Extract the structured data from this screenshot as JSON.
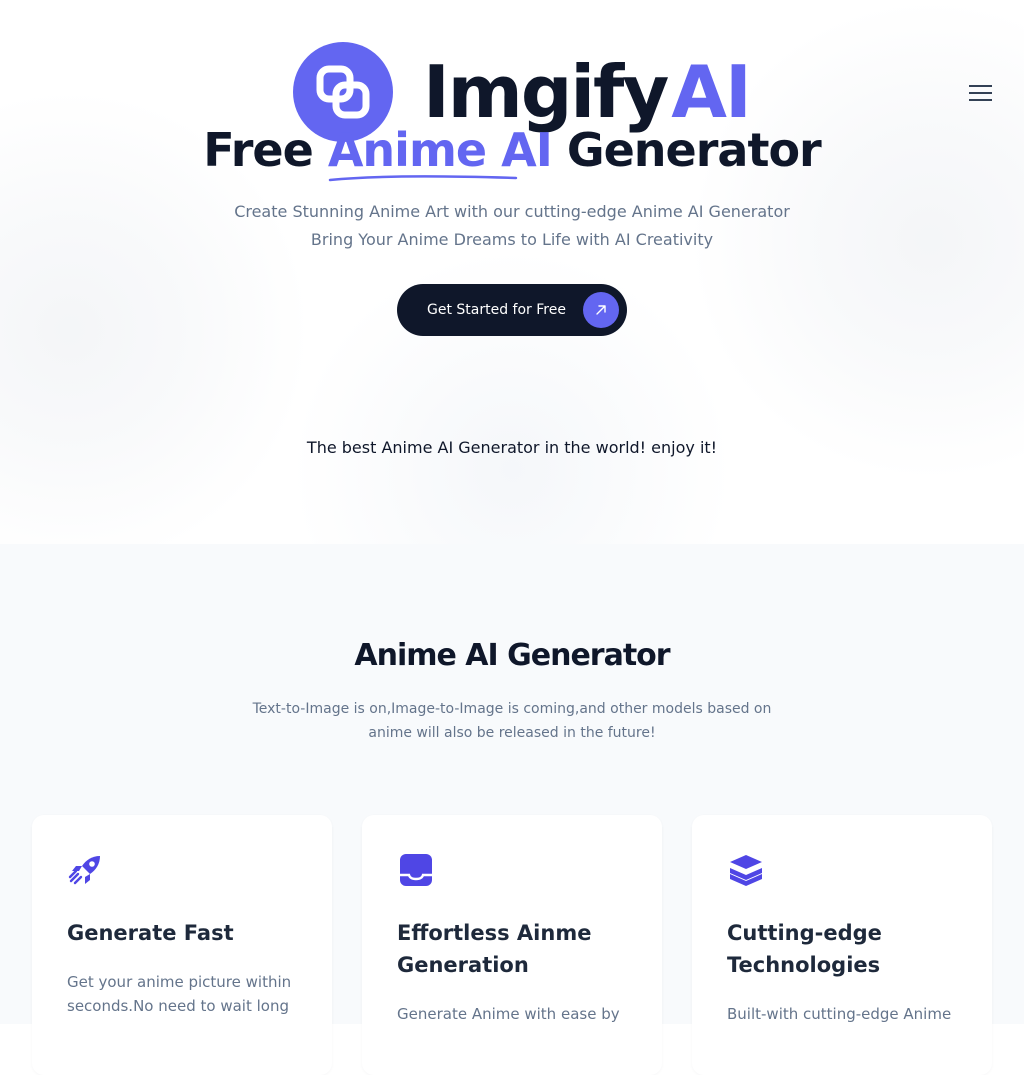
{
  "brand": {
    "name": "Imgify",
    "suffix": "AI",
    "accent_color": "#6366f1",
    "logo_icon": "overlapping-squares-logo"
  },
  "header": {
    "menu_icon": "hamburger-menu-icon"
  },
  "hero": {
    "headline_prefix": "Free",
    "headline_accent": "Anime AI",
    "headline_suffix": "Generator",
    "subtitle_line1": "Create Stunning Anime Art with our cutting-edge Anime AI Generator",
    "subtitle_line2": "Bring Your Anime Dreams to Life with AI Creativity",
    "cta_label": "Get Started for Free",
    "cta_icon": "arrow-up-right-icon",
    "tagline": "The best Anime AI Generator in the world! enjoy it!"
  },
  "features": {
    "title": "Anime AI Generator",
    "description": "Text-to-Image is on,Image-to-Image is coming,and other models based on anime will also be released in the future!",
    "cards": [
      {
        "icon": "rocket-icon",
        "title": "Generate Fast",
        "text": "Get your anime picture within seconds.No need to wait long"
      },
      {
        "icon": "inbox-tray-icon",
        "title": "Effortless Ainme Generation",
        "text": "Generate Anime with ease by"
      },
      {
        "icon": "layers-stack-icon",
        "title": "Cutting-edge Technologies",
        "text": "Built-with cutting-edge Anime"
      }
    ]
  }
}
